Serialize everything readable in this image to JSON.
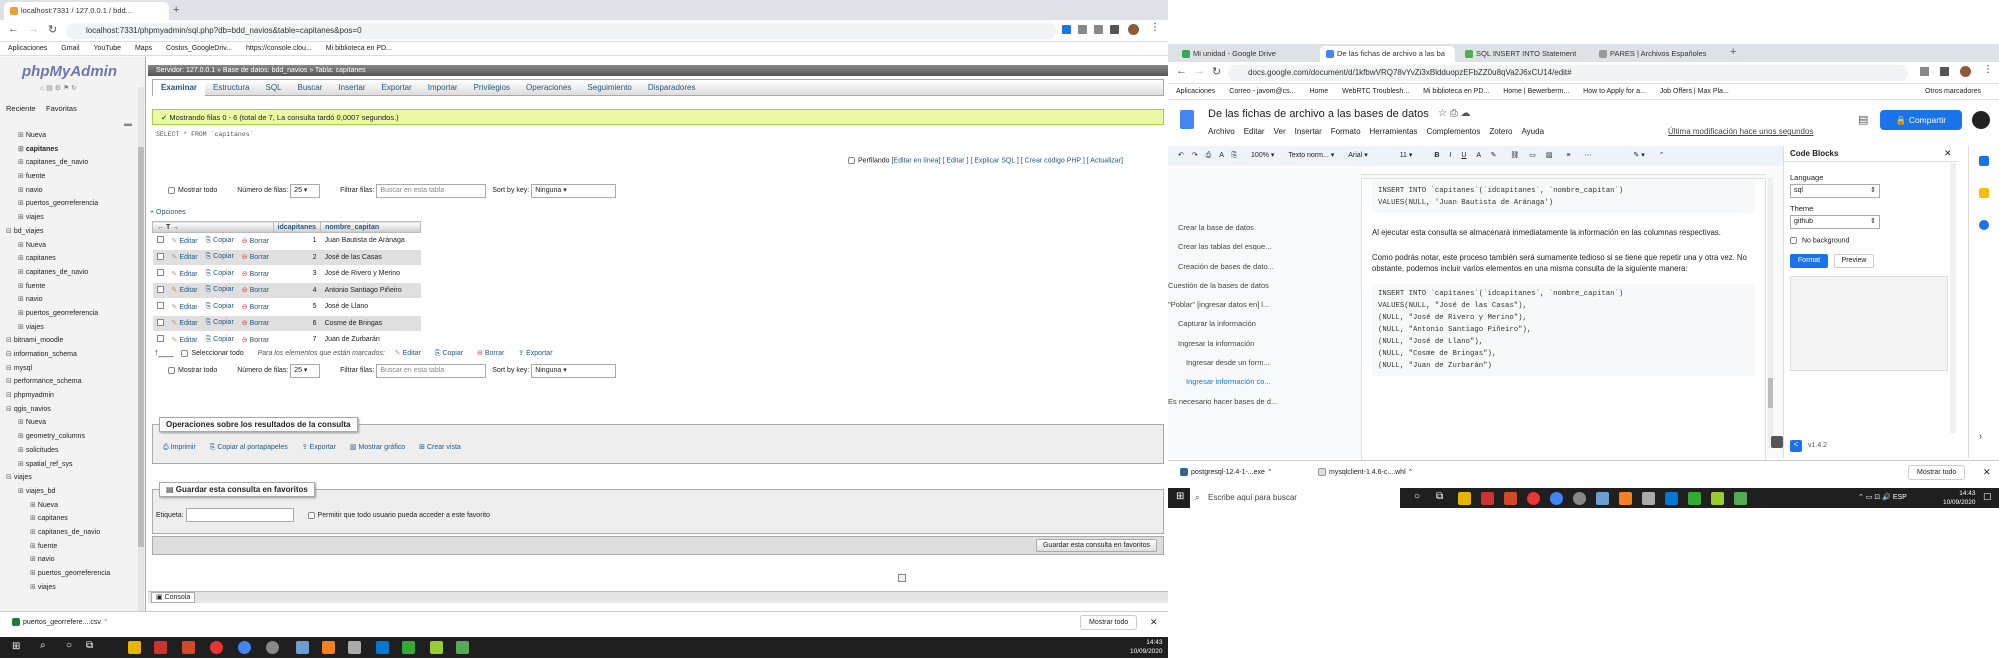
{
  "left_browser": {
    "tab_title": "localhost:7331 / 127.0.0.1 / bdd...",
    "url": "localhost:7331/phpmyadmin/sql.php?db=bdd_navios&table=capitanes&pos=0",
    "bookmarks": [
      "Aplicaciones",
      "Gmail",
      "YouTube",
      "Maps",
      "Costos_GoogleDriv...",
      "https://console.clou...",
      "Mi biblioteca en PD..."
    ]
  },
  "pma": {
    "logo": "phpMyAdmin",
    "sidebar_tabs": [
      "Reciente",
      "Favoritas"
    ],
    "tree": [
      {
        "label": "Nueva",
        "level": 2
      },
      {
        "label": "capitanes",
        "level": 2
      },
      {
        "label": "capitanes_de_navio",
        "level": 2
      },
      {
        "label": "fuente",
        "level": 2
      },
      {
        "label": "navio",
        "level": 2
      },
      {
        "label": "puertos_georreferencia",
        "level": 2
      },
      {
        "label": "viajes",
        "level": 2
      },
      {
        "label": "bd_viajes",
        "level": 1
      },
      {
        "label": "Nueva",
        "level": 2
      },
      {
        "label": "capitanes",
        "level": 2
      },
      {
        "label": "capitanes_de_navio",
        "level": 2
      },
      {
        "label": "fuente",
        "level": 2
      },
      {
        "label": "navio",
        "level": 2
      },
      {
        "label": "puertos_georreferencia",
        "level": 2
      },
      {
        "label": "viajes",
        "level": 2
      },
      {
        "label": "bitnami_moodle",
        "level": 1
      },
      {
        "label": "information_schema",
        "level": 1
      },
      {
        "label": "mysql",
        "level": 1
      },
      {
        "label": "performance_schema",
        "level": 1
      },
      {
        "label": "phpmyadmin",
        "level": 1
      },
      {
        "label": "qgis_navios",
        "level": 1
      },
      {
        "label": "Nueva",
        "level": 2
      },
      {
        "label": "geometry_columns",
        "level": 2
      },
      {
        "label": "solicitudes",
        "level": 2
      },
      {
        "label": "spatial_ref_sys",
        "level": 2
      },
      {
        "label": "viajes",
        "level": 1
      },
      {
        "label": "viajes_bd",
        "level": 2
      },
      {
        "label": "Nueva",
        "level": 3
      },
      {
        "label": "capitanes",
        "level": 3
      },
      {
        "label": "capitanes_de_navio",
        "level": 3
      },
      {
        "label": "fuente",
        "level": 3
      },
      {
        "label": "navio",
        "level": 3
      },
      {
        "label": "puertos_georreferencia",
        "level": 3
      },
      {
        "label": "viajes",
        "level": 3
      }
    ],
    "breadcrumb": "Servidor: 127.0.0.1 » Base de datos: bdd_navios » Tabla: capitanes",
    "nav_tabs": [
      "Examinar",
      "Estructura",
      "SQL",
      "Buscar",
      "Insertar",
      "Exportar",
      "Importar",
      "Privilegios",
      "Operaciones",
      "Seguimiento",
      "Disparadores"
    ],
    "success_msg": "Mostrando filas 0 - 6 (total de 7, La consulta tardó 0,0007 segundos.)",
    "query": "SELECT * FROM `capitanes`",
    "profiling_label": "Perfilando",
    "query_links": "[Editar en línea] [ Editar ] [ Explicar SQL ] [ Crear código PHP ] [ Actualizar]",
    "show_all": "Mostrar todo",
    "rows_label": "Número de filas:",
    "rows_value": "25",
    "filter_label": "Filtrar filas:",
    "filter_placeholder": "Buscar en esta tabla",
    "sort_label": "Sort by key:",
    "sort_value": "Ninguna",
    "options_label": "+ Opciones",
    "columns": [
      "idcapitanes",
      "nombre_capitan"
    ],
    "row_actions": [
      "Editar",
      "Copiar",
      "Borrar"
    ],
    "rows": [
      [
        "1",
        "Juan Bautista de Aránaga"
      ],
      [
        "2",
        "José de las Casas"
      ],
      [
        "3",
        "José de Rivero y Merino"
      ],
      [
        "4",
        "Antonio Santiago Piñeiro"
      ],
      [
        "5",
        "José de Llano"
      ],
      [
        "6",
        "Cosme de Bringas"
      ],
      [
        "7",
        "Juan de Zurbarán"
      ]
    ],
    "select_all": "Seleccionar todo",
    "marked_label": "Para los elementos que están marcados:",
    "marked_actions": [
      "Editar",
      "Copiar",
      "Borrar",
      "Exportar"
    ],
    "ops_title": "Operaciones sobre los resultados de la consulta",
    "ops": [
      "Imprimir",
      "Copiar al portapapeles",
      "Exportar",
      "Mostrar gráfico",
      "Crear vista"
    ],
    "fav_title": "Guardar esta consulta en favoritos",
    "label_label": "Etiqueta:",
    "allow_label": "Permitir que todo usuario pueda acceder a este favorito",
    "save_fav": "Guardar esta consulta en favoritos",
    "console": "Consola"
  },
  "left_download": {
    "file": "puertos_georrefere....csv",
    "show_all": "Mostrar todo"
  },
  "left_clock": {
    "time": "14:43",
    "date": "10/09/2020"
  },
  "right_browser": {
    "tabs": [
      "Mi unidad - Google Drive",
      "De las fichas de archivo a las ba",
      "SQL INSERT INTO Statement",
      "PARES | Archivos Españoles"
    ],
    "url": "docs.google.com/document/d/1kfbwVRQ78vYvZi3xBldduopzEFbZZ0u8qVa2J6xCU14/edit#",
    "bookmarks": [
      "Aplicaciones",
      "Correo - javom@cs...",
      "Home",
      "WebRTC Troublesh...",
      "Mi biblioteca en PD...",
      "Home | Bewerberm...",
      "How to Apply for a...",
      "Job Offers | Max Pla...",
      "Otros marcadores"
    ]
  },
  "docs": {
    "title": "De las fichas de archivo a las bases de datos",
    "menu": [
      "Archivo",
      "Editar",
      "Ver",
      "Insertar",
      "Formato",
      "Herramientas",
      "Complementos",
      "Zotero",
      "Ayuda"
    ],
    "last_edit": "Última modificación hace unos segundos",
    "share": "Compartir",
    "zoom": "100%",
    "style": "Texto norm...",
    "font": "Arial",
    "size": "11",
    "outline": [
      "Crear la base de datos",
      "Crear las tablas del esque...",
      "Creación de bases de dato...",
      "Cuestión de la bases de datos",
      "\"Poblar\" [ingresar datos en] l...",
      "Capturar la información",
      "Ingresar la información",
      "Ingresar desde un form...",
      "Ingresar información co...",
      "Es necesario hacer bases de d..."
    ],
    "code1_l1": "INSERT INTO `capitanes`(`idcapitanes`, `nombre_capitan`)",
    "code1_l2": "VALUES(NULL, 'Juan Bautista de Aránaga')",
    "para1": "Al ejecutar esta consulta se almacenará inmediatamente la información en las columnas respectivas.",
    "para2": "Como podrás notar, este proceso también será sumamente tedioso si se tiene que repetir una y otra vez. No obstante, podemos incluir varios elementos en una misma consulta de la siguiente manera:",
    "code2": [
      "INSERT INTO `capitanes`(`idcapitanes`, `nombre_capitan`)",
      "VALUES(NULL, \"José de las Casas\"),",
      "(NULL, \"José de Rivero y Merino\"),",
      "(NULL, \"Antonio Santiago Piñeiro\"),",
      "(NULL, \"José de Llano\"),",
      "(NULL, \"Cosme de Bringas\"),",
      "(NULL, \"Juan de Zurbarán\")"
    ]
  },
  "code_blocks": {
    "title": "Code Blocks",
    "lang_label": "Language",
    "lang_value": "sql",
    "theme_label": "Theme",
    "theme_value": "github",
    "nobg": "No background",
    "format": "Format",
    "preview": "Preview",
    "version": "v1.4.2"
  },
  "right_download": {
    "files": [
      "postgresql-12.4-1-...exe",
      "mysqlclient-1.4.6-c....whl"
    ],
    "show_all": "Mostrar todo"
  },
  "right_taskbar": {
    "search": "Escribe aquí para buscar",
    "lang": "ESP",
    "time": "14:43",
    "date": "10/09/2020"
  }
}
